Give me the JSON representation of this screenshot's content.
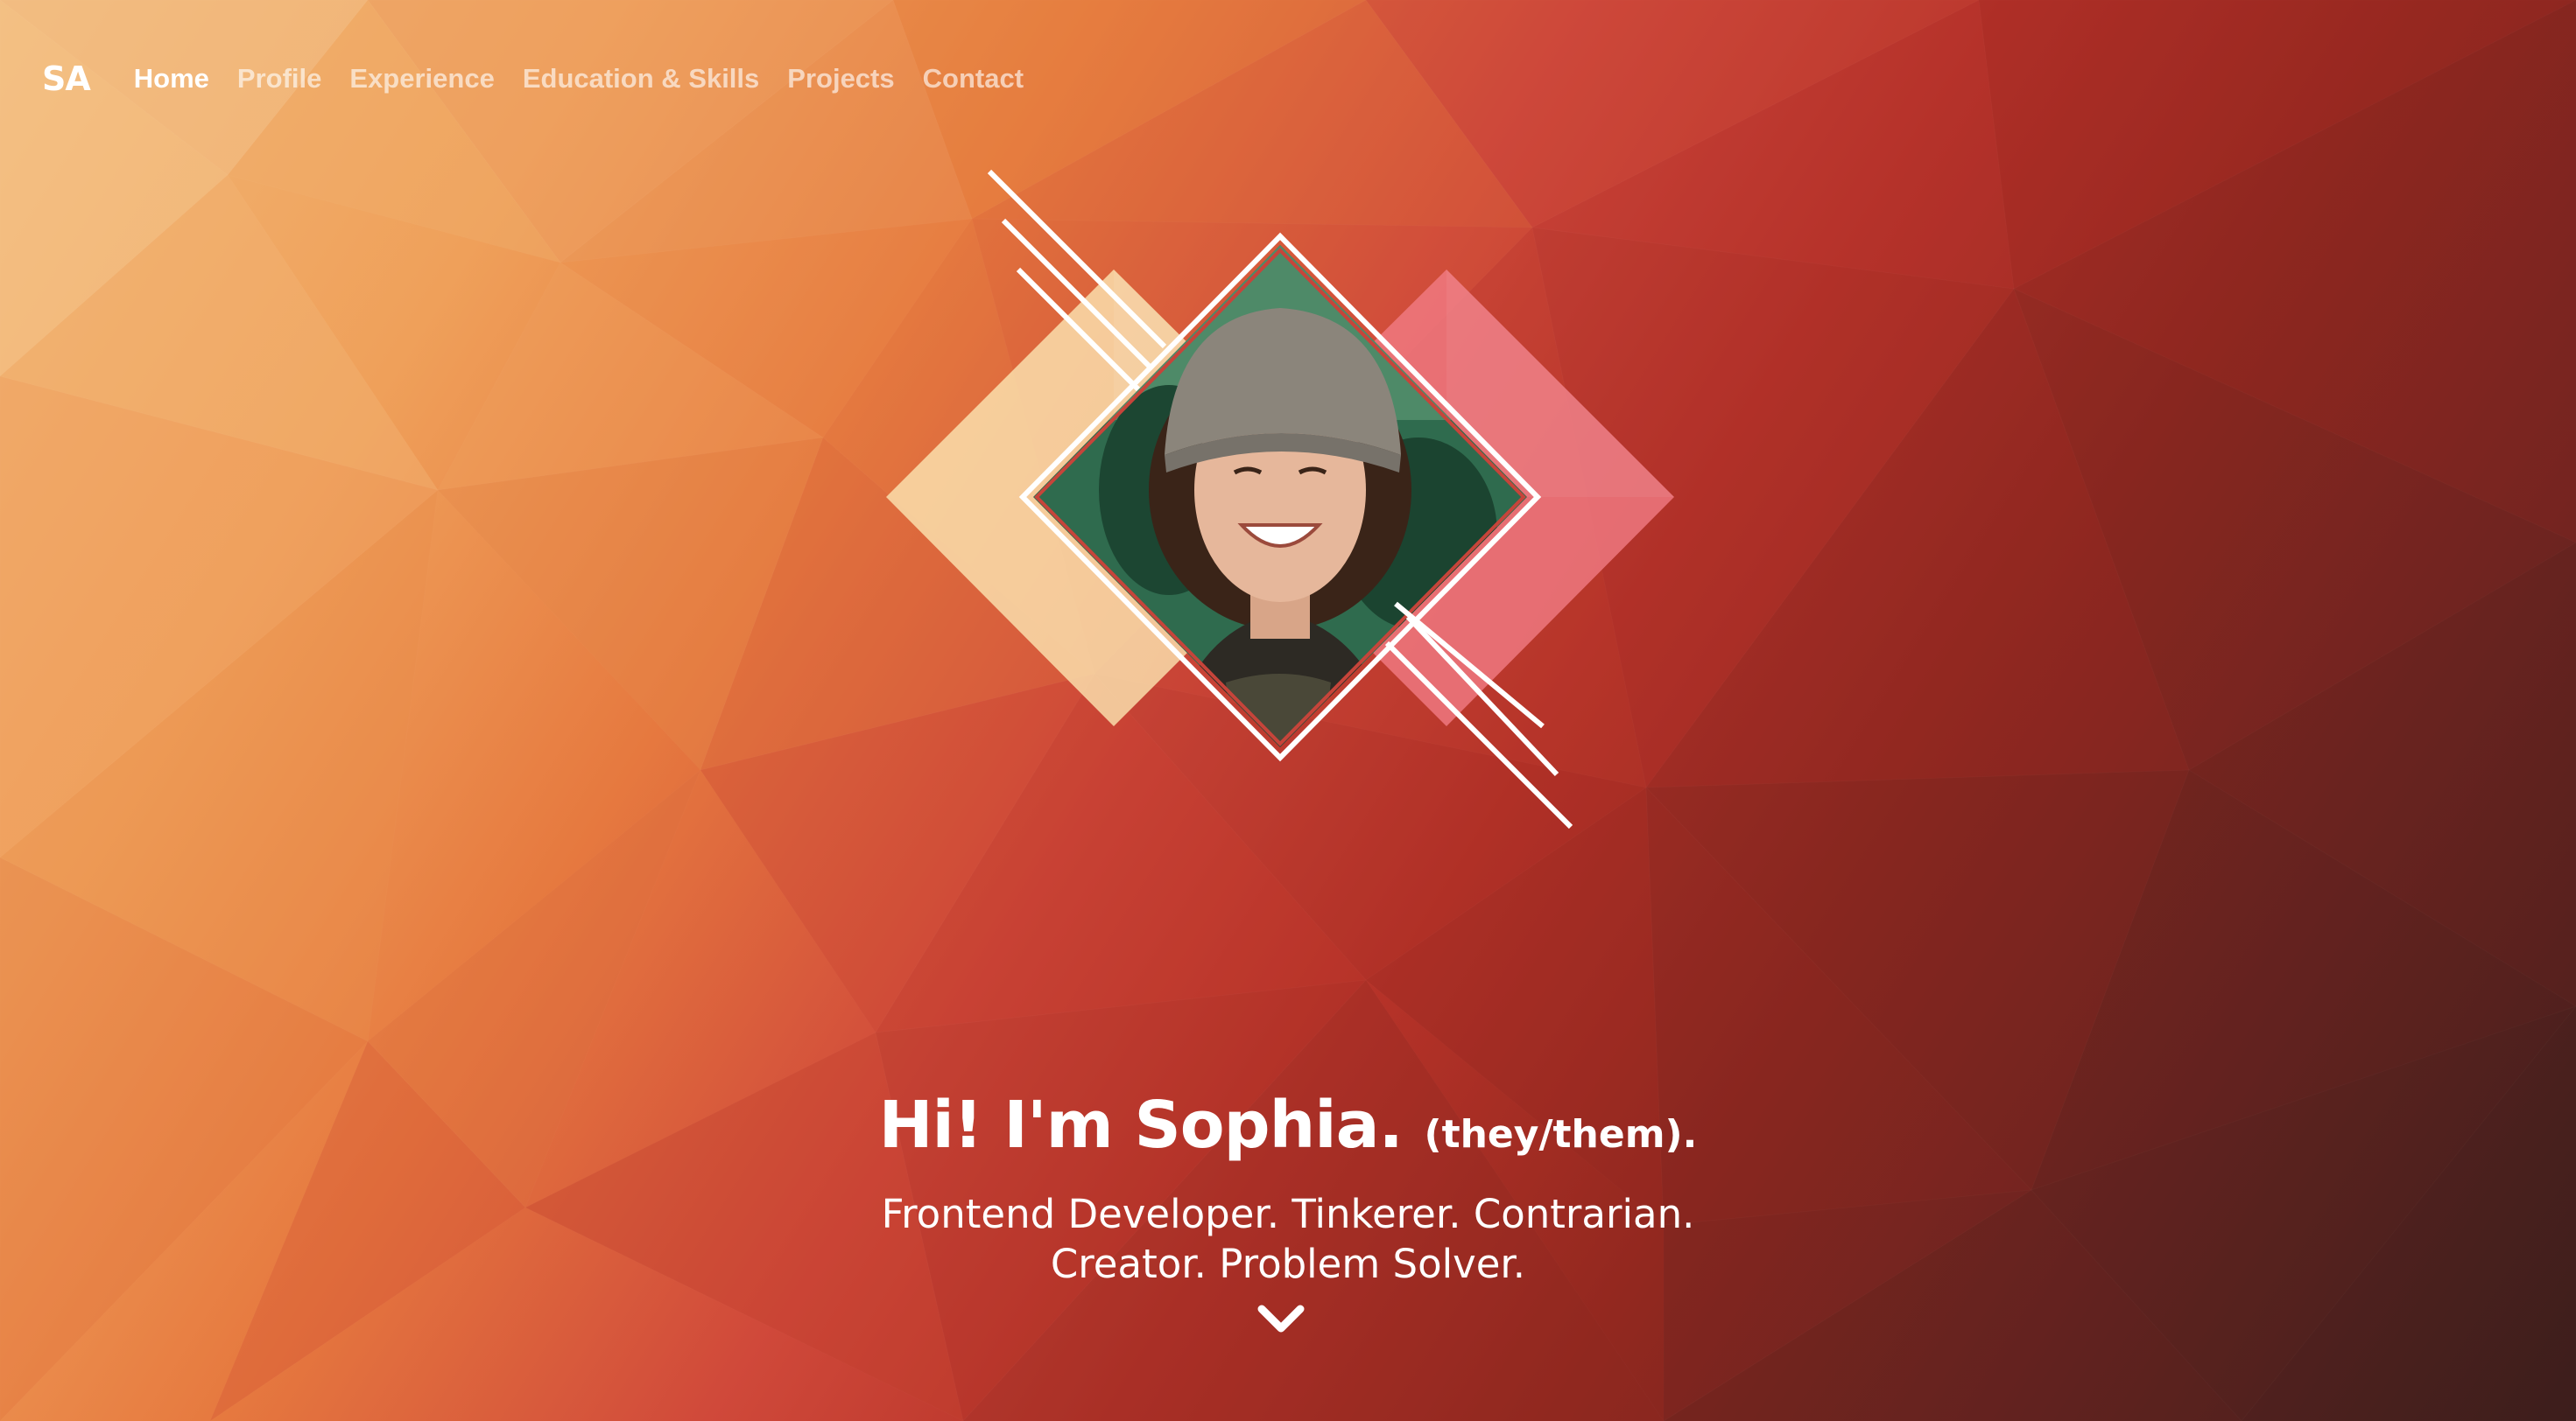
{
  "brand": {
    "logo": "SA"
  },
  "nav": {
    "items": [
      {
        "label": "Home",
        "active": true
      },
      {
        "label": "Profile",
        "active": false
      },
      {
        "label": "Experience",
        "active": false
      },
      {
        "label": "Education & Skills",
        "active": false
      },
      {
        "label": "Projects",
        "active": false
      },
      {
        "label": "Contact",
        "active": false
      }
    ]
  },
  "hero": {
    "greeting": "Hi! I'm Sophia.",
    "pronouns": "(they/them).",
    "tagline": "Frontend Developer. Tinkerer. Contrarian. Creator. Problem Solver.",
    "scroll_icon": "chevron-down-icon",
    "portrait_icon": "profile-photo"
  },
  "colors": {
    "text": "#ffffff",
    "nav_inactive": "rgba(255,255,255,0.62)",
    "bg_light": "#f2b877",
    "bg_mid": "#d0493a",
    "bg_dark": "#3e1f1d",
    "diamond_left": "#fbe3b0",
    "diamond_right": "#f07a82"
  }
}
